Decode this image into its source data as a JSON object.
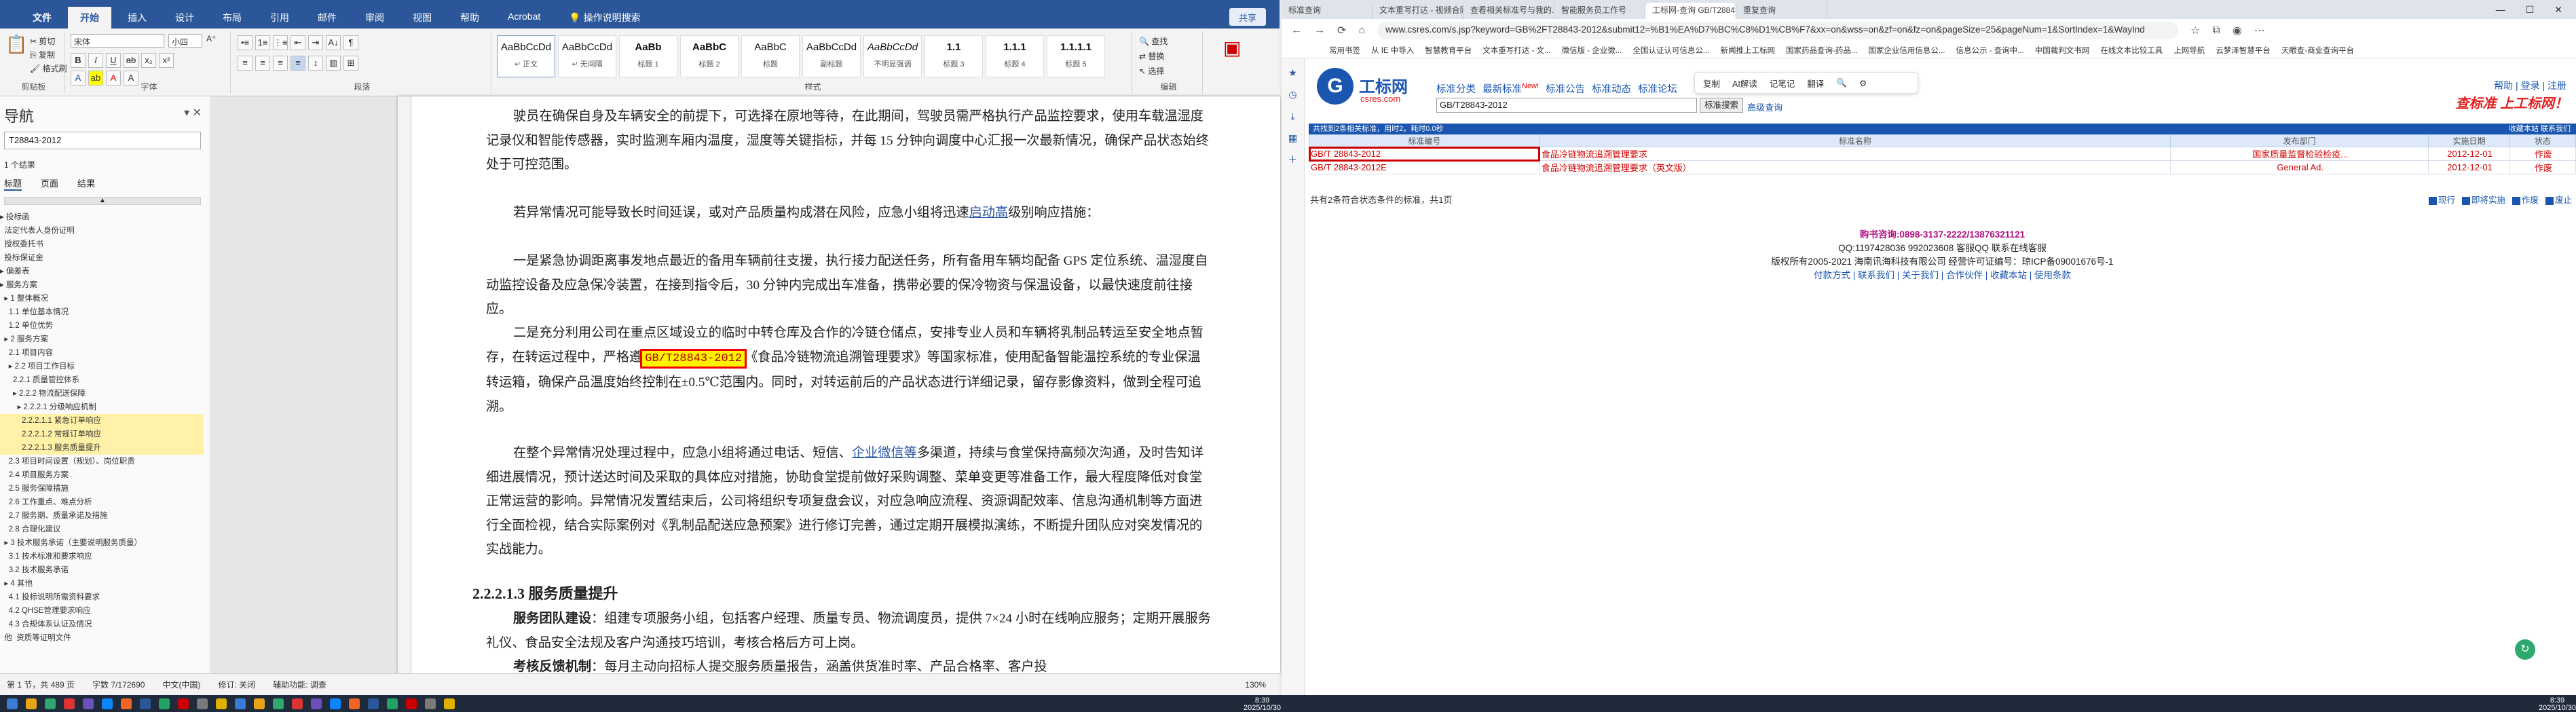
{
  "word": {
    "tabs": [
      "开始",
      "插入",
      "设计",
      "布局",
      "引用",
      "邮件",
      "审阅",
      "视图",
      "帮助",
      "Acrobat",
      "操作说明搜索"
    ],
    "share_label": "共享",
    "clipboard": {
      "cut": "剪切",
      "copy": "复制",
      "painter": "格式刷",
      "label": "剪贴板"
    },
    "font": {
      "name": "宋体",
      "size": "小四",
      "label": "字体"
    },
    "paragraph_label": "段落",
    "styles": [
      {
        "sample": "AaBbCcDd",
        "name": "↵ 正文"
      },
      {
        "sample": "AaBbCcDd",
        "name": "↵ 无间隔"
      },
      {
        "sample": "AaBb",
        "name": "标题 1"
      },
      {
        "sample": "AaBbC",
        "name": "标题 2"
      },
      {
        "sample": "AaBbC",
        "name": "标题"
      },
      {
        "sample": "AaBbCcDd",
        "name": "副标题"
      },
      {
        "sample": "AaBbCcDd",
        "name": "不明显强调"
      },
      {
        "sample": "1.1",
        "name": "标题 3"
      },
      {
        "sample": "1.1.1",
        "name": "标题 4"
      },
      {
        "sample": "1.1.1.1",
        "name": "标题 5"
      }
    ],
    "styles_label": "样式",
    "editing": {
      "find": "查找",
      "replace": "替换",
      "select": "选择",
      "label": "编辑"
    },
    "nav": {
      "title": "导航",
      "search_value": "T28843-2012",
      "results": "1 个结果",
      "tabs": [
        "标题",
        "页面",
        "结果"
      ],
      "items": [
        "▸ 投标函",
        "  法定代表人身份证明",
        "  授权委托书",
        "  投标保证金",
        "▸ 偏差表",
        "▸ 服务方案",
        "  ▸ 1 整体概况",
        "    1.1 单位基本情况",
        "    1.2 单位优势",
        "  ▸ 2 服务方案",
        "    2.1 项目内容",
        "    ▸ 2.2 项目工作目标",
        "      2.2.1 质量管控体系",
        "      ▸ 2.2.2 物流配送保障",
        "        ▸ 2.2.2.1 分级响应机制",
        "          2.2.2.1.1 紧急订单响应",
        "          2.2.2.1.2 常规订单响应",
        "          2.2.2.1.3 服务质量提升",
        "    2.3 项目时间设置（规划）、岗位职责",
        "    2.4 项目服务方案",
        "    2.5 服务保障措施",
        "    2.6 工作重点、难点分析",
        "    2.7 服务期、质量承诺及措施",
        "    2.8 合理化建议",
        "  ▸ 3 技术服务承诺（主要说明服务质量）",
        "    3.1 技术标准和要求响应",
        "    3.2 技术服务承诺",
        "  ▸ 4 其他",
        "    4.1 投标说明所需资料要求",
        "    4.2 QHSE管理要求响应",
        "    4.3 合规体系认证及情况",
        "  他  资质等证明文件"
      ]
    },
    "doc": {
      "p0": "驶员在确保自身及车辆安全的前提下，可选择在原地等待，在此期间，驾驶员需严格执行产品监控要求，使用车载温湿度记录仪和智能传感器，实时监测车厢内温度，湿度等关键指标，并每 15 分钟向调度中心汇报一次最新情况，确保产品状态始终处于可控范围。",
      "p1a": "若异常情况可能导致长时间延误，或对产品质量构成潜在风险，应急小组将迅速",
      "p1link": "启动高",
      "p1b": "级别响应措施：",
      "p2": "一是紧急协调距离事发地点最近的备用车辆前往支援，执行接力配送任务，所有备用车辆均配备 GPS 定位系统、温湿度自动监控设备及应急保冷装置，在接到指令后，30 分钟内完成出车准备，携带必要的保冷物资与保温设备，以最快速度前往接应。",
      "p3a": "二是充分利用公司在重点区域设立的临时中转仓库及合作的冷链仓储点，安排专业人员和车辆将乳制品转运至安全地点暂存，在转运过程中，严格遵",
      "p3code": "GB/T28843-2012",
      "p3b": "《食品冷链物流追溯管理要求》等国家标准，使用配备智能温控系统的专业保温转运箱，确保产品温度始终控制在±0.5℃范围内。同时，对转运前后的产品状态进行详细记录，留存影像资料，做到全程可追溯。",
      "p4a": "在整个异常情况处理过程中，应急小组将通过电话、短信、",
      "p4link": "企业微信等",
      "p4b": "多渠道，持续与食堂保持高频次沟通，及时告知详细进展情况，预计送达时间及采取的具体应对措施，协助食堂提前做好采购调整、菜单变更等准备工作，最大程度降低对食堂正常运营的影响。异常情况发置结束后，公司将组织专项复盘会议，对应急响应流程、资源调配效率、信息沟通机制等方面进行全面检视，结合实际案例对《乳制品配送应急预案》进行修订完善，通过定期开展模拟演练，不断提升团队应对突发情况的实战能力。",
      "heading": "2.2.2.1.3 服务质量提升",
      "p5label": "服务团队建设",
      "p5": "：组建专项服务小组，包括客户经理、质量专员、物流调度员，提供 7×24 小时在线响应服务；定期开展服务礼仪、食品安全法规及客户沟通技巧培训，考核合格后方可上岗。",
      "p6label": "考核反馈机制",
      "p6": "：每月主动向招标人提交服务质量报告，涵盖供货准时率、产品合格率、客户投"
    },
    "status": [
      "第 1 节，共 489 页",
      "字数 7/172690",
      "中文(中国)",
      "修订: 关闭",
      "辅助功能: 调查"
    ],
    "zoom": "130%"
  },
  "browser": {
    "tabs": [
      "标准查询",
      "文本重写打达 - 视频合同成...",
      "查看相关标准号与我的...",
      "智能服务员工作号",
      "工标网-查询 GB/T28843-2",
      "重复查询"
    ],
    "url": "www.csres.com/s.jsp?keyword=GB%2FT28843-2012&submit12=%B1%EA%D7%BC%C8%D1%CB%F7&xx=on&wss=on&zf=on&fz=on&pageSize=25&pageNum=1&SortIndex=1&WayInd",
    "bookmarks": [
      "常用书签",
      "从 IE 中导入",
      "智慧教育平台",
      "文本重写打达 - 文...",
      "微信版 - 企业微...",
      "全国认证认可信息公...",
      "新闻推上工标网",
      "国家药品查询-药品...",
      "国家企业信用信息公...",
      "信息公示 - 查询中...",
      "中国裁判文书网",
      "在线文本比较工具",
      "上网导航",
      "云梦泽智慧平台",
      "天眼查-商业查询平台"
    ],
    "site": {
      "logo_cn": "工标网",
      "logo_en": "csres.com",
      "nav": [
        "标准分类",
        "最新标准",
        "New!",
        "标准公告",
        "标准动态",
        "标准论坛"
      ],
      "query": "GB/T28843-2012",
      "search_btn": "标准搜索",
      "adv": "高级查询",
      "popup": [
        "复制",
        "AI解读",
        "记笔记",
        "翻译"
      ],
      "topright": "帮助 | 登录 | 注册",
      "slogan": "查标准 上工标网！",
      "bluebar_left": "共找到2条相关标准，用时2。耗时0.0秒",
      "bluebar_right": "收藏本站  联系我们",
      "headers": [
        "标准编号",
        "标准名称",
        "发布部门",
        "实施日期",
        "状态"
      ],
      "rows": [
        [
          "GB/T 28843-2012",
          "食品冷链物流追溯管理要求",
          "国家质量监督检验检疫...",
          "2012-12-01",
          "作废"
        ],
        [
          "GB/T 28843-2012E",
          "食品冷链物流追溯管理要求（英文版）",
          "General Ad.",
          "2012-12-01",
          "作废"
        ]
      ],
      "summary": "共有2条符合状态条件的标准，共1页",
      "filters": [
        "现行",
        "即将实施",
        "作废",
        "废止"
      ],
      "hotline": "购书咨询:0898-3137-2222/13876321121",
      "qq": "QQ:1197428036 992023608  客服QQ  联系在线客服",
      "copyright": "版权所有2005-2021 海南讯海科技有限公司 经营许可证编号：琼ICP备09001676号-1",
      "links": "付款方式 | 联系我们 | 关于我们 | 合作伙伴 | 收藏本站 | 使用条款"
    }
  },
  "taskbar": {
    "time": "8:39",
    "date": "2025/10/30"
  }
}
